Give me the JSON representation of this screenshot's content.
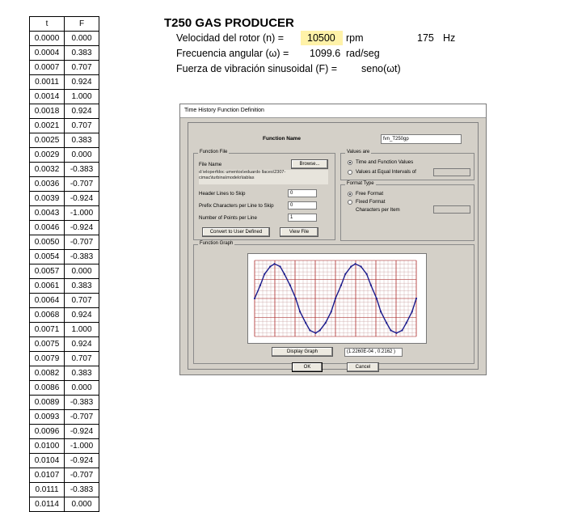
{
  "table": {
    "headers": [
      "t",
      "F"
    ],
    "rows": [
      [
        "0.0000",
        "0.000"
      ],
      [
        "0.0004",
        "0.383"
      ],
      [
        "0.0007",
        "0.707"
      ],
      [
        "0.0011",
        "0.924"
      ],
      [
        "0.0014",
        "1.000"
      ],
      [
        "0.0018",
        "0.924"
      ],
      [
        "0.0021",
        "0.707"
      ],
      [
        "0.0025",
        "0.383"
      ],
      [
        "0.0029",
        "0.000"
      ],
      [
        "0.0032",
        "-0.383"
      ],
      [
        "0.0036",
        "-0.707"
      ],
      [
        "0.0039",
        "-0.924"
      ],
      [
        "0.0043",
        "-1.000"
      ],
      [
        "0.0046",
        "-0.924"
      ],
      [
        "0.0050",
        "-0.707"
      ],
      [
        "0.0054",
        "-0.383"
      ],
      [
        "0.0057",
        "0.000"
      ],
      [
        "0.0061",
        "0.383"
      ],
      [
        "0.0064",
        "0.707"
      ],
      [
        "0.0068",
        "0.924"
      ],
      [
        "0.0071",
        "1.000"
      ],
      [
        "0.0075",
        "0.924"
      ],
      [
        "0.0079",
        "0.707"
      ],
      [
        "0.0082",
        "0.383"
      ],
      [
        "0.0086",
        "0.000"
      ],
      [
        "0.0089",
        "-0.383"
      ],
      [
        "0.0093",
        "-0.707"
      ],
      [
        "0.0096",
        "-0.924"
      ],
      [
        "0.0100",
        "-1.000"
      ],
      [
        "0.0104",
        "-0.924"
      ],
      [
        "0.0107",
        "-0.707"
      ],
      [
        "0.0111",
        "-0.383"
      ],
      [
        "0.0114",
        "0.000"
      ]
    ]
  },
  "header": {
    "title": "T250 GAS PRODUCER",
    "rotor_speed_label": "Velocidad del rotor (n) =",
    "rotor_speed_value": "10500",
    "rotor_speed_unit": "rpm",
    "frequency_value": "175",
    "frequency_unit": "Hz",
    "angular_freq_label": "Frecuencia angular (ω) =",
    "angular_freq_value": "1099.6",
    "angular_freq_unit": "rad/seg",
    "force_label": "Fuerza de vibración sinusoidal (F) =",
    "force_value": "seno(ωt)"
  },
  "dialog": {
    "title": "Time History Function Definition",
    "function_name_label": "Function Name",
    "function_name_value": "fvn_T250gp",
    "function_file": {
      "group_label": "Function File",
      "file_name_label": "File Name",
      "browse_label": "Browse...",
      "path_text": "d:\\eloperfdoc umentos\\eduardo llaces\\2307-cimac\\turbina\\modelo\\tablas",
      "header_lines_label": "Header Lines to Skip",
      "header_lines_value": "0",
      "prefix_chars_label": "Prefix Characters per Line to Skip",
      "prefix_chars_value": "0",
      "points_per_line_label": "Number of Points per Line",
      "points_per_line_value": "1",
      "convert_label": "Convert to User Defined",
      "view_file_label": "View File"
    },
    "values_are": {
      "group_label": "Values are",
      "option1": "Time and Function Values",
      "option2": "Values at Equal Intervals of"
    },
    "format_type": {
      "group_label": "Format Type",
      "option1": "Free Format",
      "option2": "Fixed Format",
      "chars_per_item_label": "Characters per Item"
    },
    "graph": {
      "group_label": "Function Graph",
      "display_label": "Display Graph",
      "readout": "(1.2260E-04 , 0.2162 )",
      "line_color": "#1a1a8c",
      "grid_major_color": "#b03030",
      "grid_minor_color": "#c8a0a0"
    },
    "ok_label": "OK",
    "cancel_label": "Cancel"
  },
  "chart_data": {
    "type": "line",
    "x": [
      0.0,
      0.0004,
      0.0007,
      0.0011,
      0.0014,
      0.0018,
      0.0021,
      0.0025,
      0.0029,
      0.0032,
      0.0036,
      0.0039,
      0.0043,
      0.0046,
      0.005,
      0.0054,
      0.0057,
      0.0061,
      0.0064,
      0.0068,
      0.0071,
      0.0075,
      0.0079,
      0.0082,
      0.0086,
      0.0089,
      0.0093,
      0.0096,
      0.01,
      0.0104,
      0.0107,
      0.0111,
      0.0114
    ],
    "series": [
      {
        "values": [
          0.0,
          0.383,
          0.707,
          0.924,
          1.0,
          0.924,
          0.707,
          0.383,
          0.0,
          -0.383,
          -0.707,
          -0.924,
          -1.0,
          -0.924,
          -0.707,
          -0.383,
          0.0,
          0.383,
          0.707,
          0.924,
          1.0,
          0.924,
          0.707,
          0.383,
          0.0,
          -0.383,
          -0.707,
          -0.924,
          -1.0,
          -0.924,
          -0.707,
          -0.383,
          0.0
        ]
      }
    ],
    "xlim": [
      0,
      0.0114
    ],
    "ylim": [
      -1.1,
      1.1
    ],
    "grid": true,
    "title": "",
    "xlabel": "",
    "ylabel": ""
  }
}
